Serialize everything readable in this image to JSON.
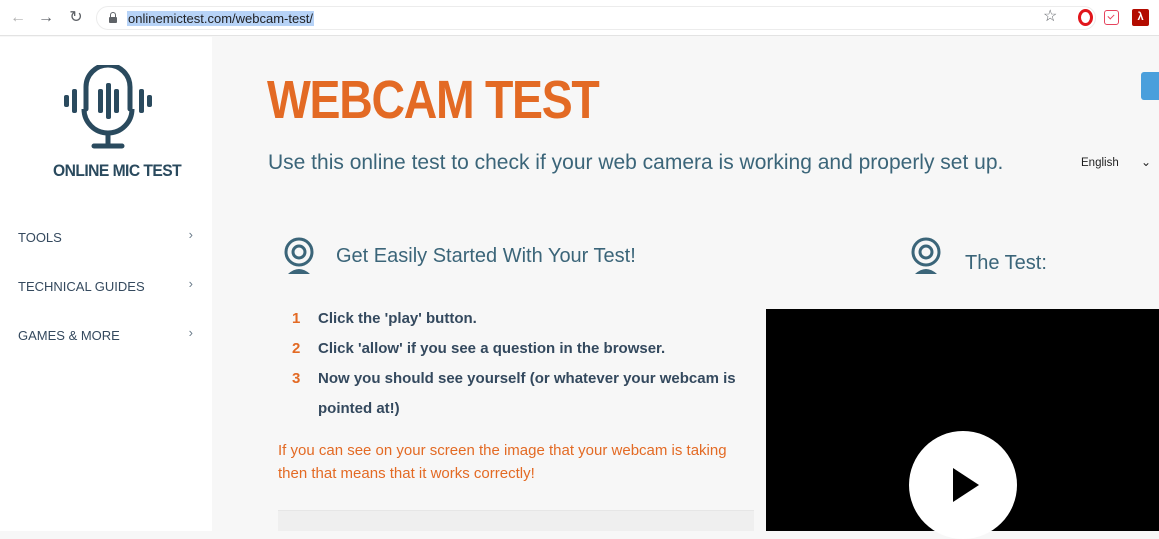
{
  "browser": {
    "url": "onlinemictest.com/webcam-test/",
    "back_icon": "arrow-left-icon",
    "forward_icon": "arrow-right-icon",
    "reload_icon": "reload-icon",
    "extensions": [
      "opera-icon",
      "pocket-icon",
      "acrobat-icon"
    ]
  },
  "sidebar": {
    "logo_text": "ONLINE MIC TEST",
    "items": [
      {
        "label": "TOOLS",
        "chevron": "›"
      },
      {
        "label": "TECHNICAL GUIDES",
        "chevron": "›"
      },
      {
        "label": "GAMES & MORE",
        "chevron": "›"
      }
    ]
  },
  "main": {
    "title": "WEBCAM TEST",
    "subtitle": "Use this online test to check if your web camera is working and properly set up.",
    "language": "English",
    "left_section": {
      "heading": "Get Easily Started With Your Test!",
      "steps": [
        {
          "num": "1",
          "text": "Click the 'play' button."
        },
        {
          "num": "2",
          "text": "Click 'allow' if you see a question in the browser."
        },
        {
          "num": "3",
          "text": "Now you should see yourself (or whatever your webcam is pointed at!)"
        }
      ],
      "note": "If you can see on your screen the image that your webcam is taking then that means that it works correctly!"
    },
    "right_section": {
      "heading": "The Test:"
    }
  },
  "colors": {
    "accent": "#e36a24",
    "heading": "#3b6579",
    "logo": "#2a4a5e",
    "video_bg": "#000000"
  }
}
